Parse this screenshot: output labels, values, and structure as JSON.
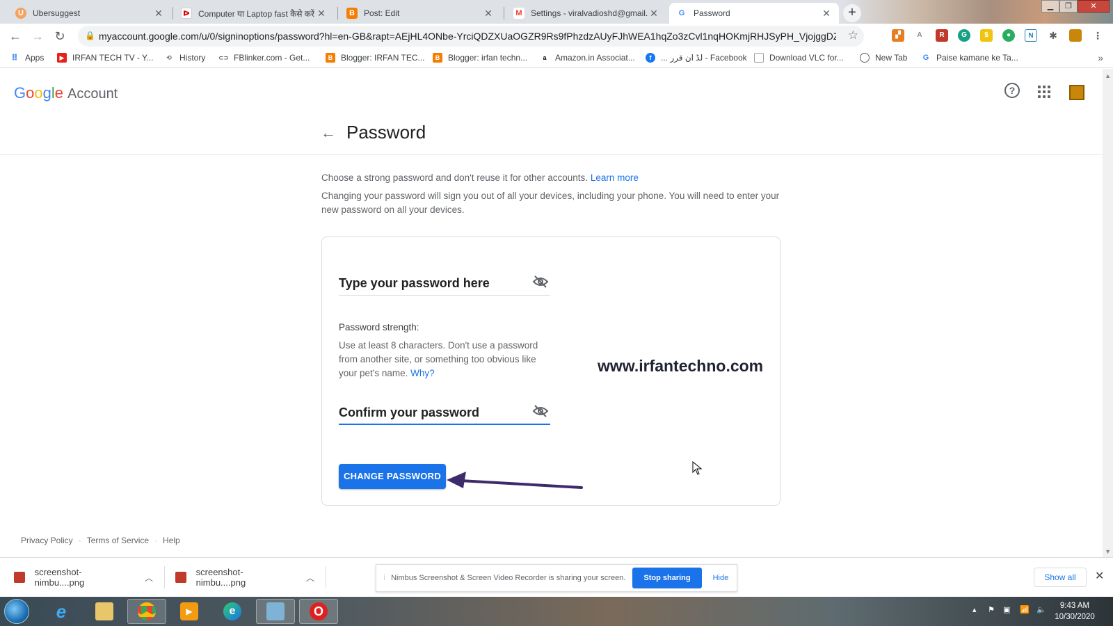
{
  "browser": {
    "tabs": [
      {
        "label": "Ubersuggest",
        "favicon": "ubersuggest-icon",
        "active": false
      },
      {
        "label": "Computer या Laptop fast कैसे करें",
        "favicon": "irfan-tech-icon",
        "active": false
      },
      {
        "label": "Post: Edit",
        "favicon": "blogger-icon",
        "active": false
      },
      {
        "label": "Settings - viralvadioshd@gmail...",
        "favicon": "gmail-icon",
        "active": false
      },
      {
        "label": "Password",
        "favicon": "google-icon",
        "active": true
      }
    ],
    "new_tab_symbol": "+",
    "url": "myaccount.google.com/u/0/signinoptions/password?hl=en-GB&rapt=AEjHL4ONbe-YrciQDZXUaOGZR9Rs9fPhzdzAUyFJhWEA1hqZo3zCvl1nqHOKmjRHJSyPH_VjojggDZMkKz...",
    "bookmarks": [
      {
        "label": "Apps",
        "icon": "apps-grid-icon"
      },
      {
        "label": "IRFAN TECH TV - Y...",
        "icon": "youtube-icon"
      },
      {
        "label": "History",
        "icon": "history-icon"
      },
      {
        "label": "FBlinker.com - Get...",
        "icon": "link-icon"
      },
      {
        "label": "Blogger: IRFAN TEC...",
        "icon": "blogger-icon"
      },
      {
        "label": "Blogger: irfan techn...",
        "icon": "blogger-icon"
      },
      {
        "label": "Amazon.in Associat...",
        "icon": "amazon-icon"
      },
      {
        "label": "... لڈ ان قرر - Facebook",
        "icon": "facebook-icon"
      },
      {
        "label": "Download VLC for...",
        "icon": "vlc-icon"
      },
      {
        "label": "New Tab",
        "icon": "globe-icon"
      },
      {
        "label": "Paise kamane ke Ta...",
        "icon": "google-icon"
      }
    ],
    "more_bookmarks": "»"
  },
  "account": {
    "logo_letters": [
      "G",
      "o",
      "o",
      "g",
      "l",
      "e"
    ],
    "logo_suffix": "Account",
    "page_title": "Password",
    "intro_line1": "Choose a strong password and don't reuse it for other accounts.",
    "learn_more": "Learn more",
    "intro_line2": "Changing your password will sign you out of all your devices, including your phone. You will need to enter your new password on all your devices.",
    "password_placeholder": "Type your password here",
    "strength_label": "Password strength:",
    "strength_hint": "Use at least 8 characters. Don't use a password from another site, or something too obvious like your pet's name.",
    "why_link": "Why?",
    "confirm_placeholder": "Confirm your password",
    "change_button": "CHANGE PASSWORD",
    "watermark": "www.irfantechno.com"
  },
  "footer": {
    "links": [
      "Privacy Policy",
      "Terms of Service",
      "Help"
    ]
  },
  "downloads": {
    "items": [
      "screenshot-nimbu....png",
      "screenshot-nimbu....png"
    ],
    "sharing_notice": "Nimbus Screenshot & Screen Video Recorder is sharing your screen.",
    "stop_sharing": "Stop sharing",
    "hide": "Hide",
    "show_all": "Show all"
  },
  "taskbar": {
    "apps": [
      "internet-explorer-icon",
      "file-explorer-icon",
      "chrome-icon",
      "media-player-icon",
      "edge-icon",
      "notepad-icon",
      "opera-icon"
    ],
    "time": "9:43 AM",
    "date": "10/30/2020"
  },
  "colors": {
    "accent": "#1a73e8",
    "annotation_arrow": "#3d2b6b"
  }
}
